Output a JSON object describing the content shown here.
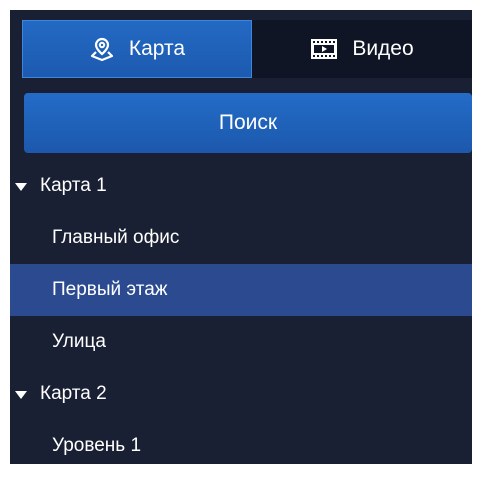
{
  "tabs": {
    "map": {
      "label": "Карта",
      "icon": "map-pin-icon"
    },
    "video": {
      "label": "Видео",
      "icon": "video-film-icon"
    }
  },
  "search_button": {
    "label": "Поиск"
  },
  "tree": {
    "groups": [
      {
        "label": "Карта 1",
        "expanded": true,
        "items": [
          {
            "label": "Главный офис",
            "selected": false
          },
          {
            "label": "Первый этаж",
            "selected": true
          },
          {
            "label": "Улица",
            "selected": false
          }
        ]
      },
      {
        "label": "Карта 2",
        "expanded": true,
        "items": [
          {
            "label": "Уровень 1",
            "selected": false
          }
        ]
      }
    ]
  },
  "colors": {
    "panel_background": "#1a2034",
    "active_tab": "#2369c3",
    "selected_row": "#2b4a90",
    "text": "#ffffff"
  }
}
